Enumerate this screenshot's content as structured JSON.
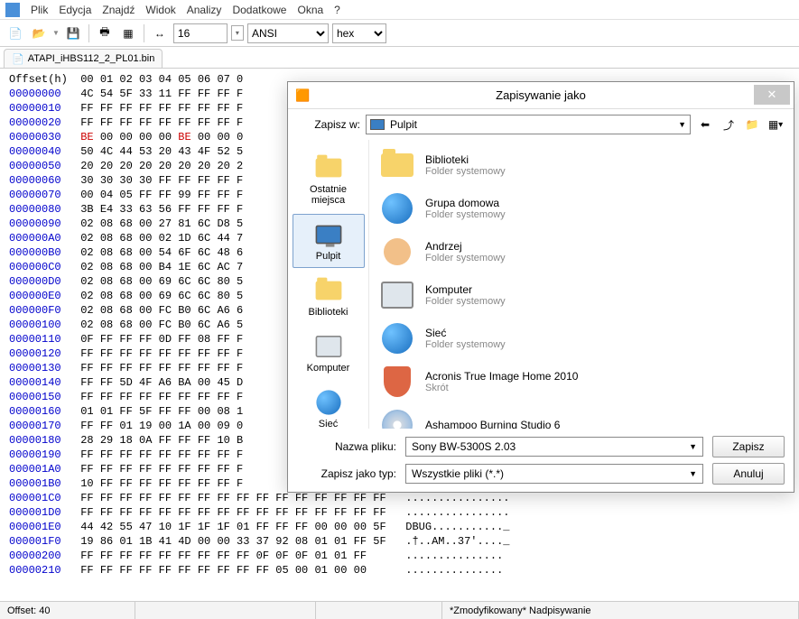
{
  "menu": {
    "items": [
      "Plik",
      "Edycja",
      "Znajdź",
      "Widok",
      "Analizy",
      "Dodatkowe",
      "Okna",
      "?"
    ]
  },
  "toolbar": {
    "width": "16",
    "encoding": "ANSI",
    "mode": "hex"
  },
  "tabs": [
    {
      "label": "ATAPI_iHBS112_2_PL01.bin"
    }
  ],
  "hex": {
    "header": "Offset(h)  00 01 02 03 04 05 06 07 0",
    "rows": [
      {
        "off": "00000000",
        "b": "4C 54 5F 33 11 FF FF FF F"
      },
      {
        "off": "00000010",
        "b": "FF FF FF FF FF FF FF FF F"
      },
      {
        "off": "00000020",
        "b": "FF FF FF FF FF FF FF FF F"
      },
      {
        "off": "00000030",
        "b": "BE 00 00 00 00 BE 00 00 0",
        "red": [
          0,
          5
        ]
      },
      {
        "off": "00000040",
        "b": "50 4C 44 53 20 43 4F 52 5"
      },
      {
        "off": "00000050",
        "b": "20 20 20 20 20 20 20 20 2"
      },
      {
        "off": "00000060",
        "b": "30 30 30 30 FF FF FF FF F"
      },
      {
        "off": "00000070",
        "b": "00 04 05 FF FF 99 FF FF F"
      },
      {
        "off": "00000080",
        "b": "3B E4 33 63 56 FF FF FF F"
      },
      {
        "off": "00000090",
        "b": "02 08 68 00 27 81 6C D8 5"
      },
      {
        "off": "000000A0",
        "b": "02 08 68 00 02 1D 6C 44 7"
      },
      {
        "off": "000000B0",
        "b": "02 08 68 00 54 6F 6C 48 6"
      },
      {
        "off": "000000C0",
        "b": "02 08 68 00 B4 1E 6C AC 7"
      },
      {
        "off": "000000D0",
        "b": "02 08 68 00 69 6C 6C 80 5"
      },
      {
        "off": "000000E0",
        "b": "02 08 68 00 69 6C 6C 80 5"
      },
      {
        "off": "000000F0",
        "b": "02 08 68 00 FC B0 6C A6 6"
      },
      {
        "off": "00000100",
        "b": "02 08 68 00 FC B0 6C A6 5"
      },
      {
        "off": "00000110",
        "b": "0F FF FF FF 0D FF 08 FF F"
      },
      {
        "off": "00000120",
        "b": "FF FF FF FF FF FF FF FF F"
      },
      {
        "off": "00000130",
        "b": "FF FF FF FF FF FF FF FF F"
      },
      {
        "off": "00000140",
        "b": "FF FF 5D 4F A6 BA 00 45 D"
      },
      {
        "off": "00000150",
        "b": "FF FF FF FF FF FF FF FF F"
      },
      {
        "off": "00000160",
        "b": "01 01 FF 5F FF FF 00 08 1"
      },
      {
        "off": "00000170",
        "b": "FF FF 01 19 00 1A 00 09 0"
      },
      {
        "off": "00000180",
        "b": "28 29 18 0A FF FF FF 10 B"
      },
      {
        "off": "00000190",
        "b": "FF FF FF FF FF FF FF FF F"
      },
      {
        "off": "000001A0",
        "b": "FF FF FF FF FF FF FF FF F"
      },
      {
        "off": "000001B0",
        "b": "10 FF FF FF FF FF FF FF F"
      }
    ],
    "lower": [
      {
        "off": "000001C0",
        "b": "FF FF FF FF FF FF FF FF FF FF FF FF FF FF FF FF",
        "a": "................"
      },
      {
        "off": "000001D0",
        "b": "FF FF FF FF FF FF FF FF FF FF FF FF FF FF FF FF",
        "a": "................"
      },
      {
        "off": "000001E0",
        "b": "44 42 55 47 10 1F 1F 1F 01 FF FF FF 00 00 00 5F",
        "a": "DBUG..........._"
      },
      {
        "off": "000001F0",
        "b": "19 86 01 1B 41 4D 00 00 33 37 92 08 01 01 FF 5F",
        "a": ".†..AM..37'...._"
      },
      {
        "off": "00000200",
        "b": "FF FF FF FF FF FF FF FF FF 0F 0F 0F 01 01 FF   ",
        "a": "..............."
      },
      {
        "off": "00000210",
        "b": "FF FF FF FF FF FF FF FF FF FF 05 00 01 00 00   ",
        "a": "..............."
      }
    ]
  },
  "status": {
    "left": "Offset: 40",
    "mid1": "",
    "mid2": "",
    "right": "*Zmodyfikowany* Nadpisywanie"
  },
  "dialog": {
    "title": "Zapisywanie jako",
    "save_in_label": "Zapisz w:",
    "save_in_value": "Pulpit",
    "places": [
      {
        "label": "Ostatnie miejsca"
      },
      {
        "label": "Pulpit",
        "selected": true
      },
      {
        "label": "Biblioteki"
      },
      {
        "label": "Komputer"
      },
      {
        "label": "Sieć"
      }
    ],
    "items": [
      {
        "name": "Biblioteki",
        "sub": "Folder systemowy",
        "icon": "folder"
      },
      {
        "name": "Grupa domowa",
        "sub": "Folder systemowy",
        "icon": "users"
      },
      {
        "name": "Andrzej",
        "sub": "Folder systemowy",
        "icon": "user"
      },
      {
        "name": "Komputer",
        "sub": "Folder systemowy",
        "icon": "pc"
      },
      {
        "name": "Sieć",
        "sub": "Folder systemowy",
        "icon": "globe"
      },
      {
        "name": "Acronis True Image Home 2010",
        "sub": "Skrót",
        "icon": "shield"
      },
      {
        "name": "Ashampoo Burning Studio 6",
        "sub": "",
        "icon": "disk"
      }
    ],
    "filename_label": "Nazwa pliku:",
    "filename_value": "Sony BW-5300S 2.03",
    "type_label": "Zapisz jako typ:",
    "type_value": "Wszystkie pliki (*.*)",
    "save_btn": "Zapisz",
    "cancel_btn": "Anuluj"
  }
}
